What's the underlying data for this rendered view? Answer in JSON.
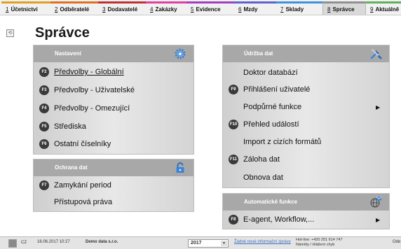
{
  "tabs": [
    {
      "num": "1",
      "label": "Účetnictví",
      "color": "#e0a020"
    },
    {
      "num": "2",
      "label": "Odběratelé",
      "color": "#e07020"
    },
    {
      "num": "3",
      "label": "Dodavatelé",
      "color": "#c03030"
    },
    {
      "num": "4",
      "label": "Zakázky",
      "color": "#e040a0"
    },
    {
      "num": "5",
      "label": "Evidence",
      "color": "#a040c0"
    },
    {
      "num": "6",
      "label": "Mzdy",
      "color": "#6060d0"
    },
    {
      "num": "7",
      "label": "Sklady",
      "color": "#4090e0"
    },
    {
      "num": "8",
      "label": "Správce",
      "color": "#909090"
    },
    {
      "num": "9",
      "label": "Aktuálně",
      "color": "#60b060"
    }
  ],
  "active_tab": "Správce",
  "side_icon": "restore-icon",
  "page_title": "Správce",
  "panels": {
    "nastaveni": {
      "title": "Nastavení",
      "icon": "gear-icon",
      "items": [
        {
          "key": "F2",
          "label": "Předvolby - Globální"
        },
        {
          "key": "F3",
          "label": "Předvolby - Uživatelské"
        },
        {
          "key": "F4",
          "label": "Předvolby - Omezující"
        },
        {
          "key": "F5",
          "label": "Střediska"
        },
        {
          "key": "F6",
          "label": "Ostatní číselníky"
        }
      ]
    },
    "ochrana": {
      "title": "Ochrana dat",
      "icon": "lock-icon",
      "items": [
        {
          "key": "F7",
          "label": "Zamykání period"
        },
        {
          "key": "",
          "label": "Přístupová práva"
        }
      ]
    },
    "udrzba": {
      "title": "Údržba dat",
      "icon": "tools-icon",
      "items": [
        {
          "key": "",
          "label": "Doktor databází"
        },
        {
          "key": "F9",
          "label": "Přihlášení uživatelé"
        },
        {
          "key": "",
          "label": "Podpůrné funkce"
        },
        {
          "key": "F10",
          "label": "Přehled událostí"
        },
        {
          "key": "",
          "label": "Import z cizích formátů"
        },
        {
          "key": "F11",
          "label": "Záloha dat"
        },
        {
          "key": "",
          "label": "Obnova dat"
        }
      ]
    },
    "automaticke": {
      "title": "Automatické funkce",
      "icon": "globe-mail-icon",
      "items": [
        {
          "key": "F8",
          "label": "E-agent, Workflow,..."
        }
      ]
    }
  },
  "status": {
    "cz": "CZ",
    "datetime": "16.06.2017 10:27",
    "company": "Demo data s.r.o.",
    "year": "2017",
    "info": "Žádné nové informační zprávy",
    "hotline": "Hot-line: +420 251 614 747",
    "hotline2": "Náměty / Hlášení chyb",
    "last": "Ode"
  }
}
